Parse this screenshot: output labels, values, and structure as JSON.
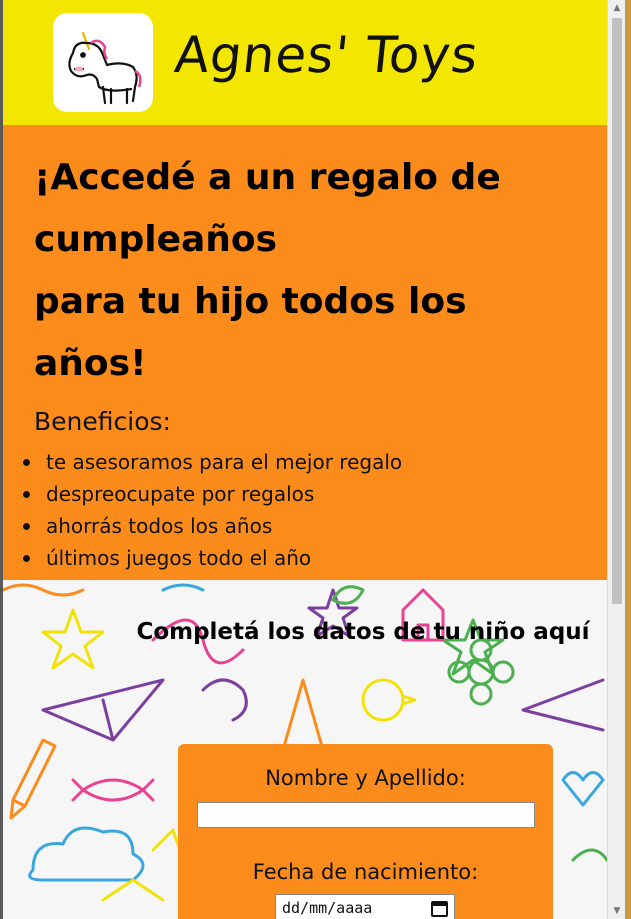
{
  "header": {
    "brand": "Agnes' Toys",
    "logo_icon": "unicorn-icon"
  },
  "hero": {
    "title_lines": [
      "¡Accedé a un regalo de",
      "cumpleaños",
      "para tu hijo todos los",
      "años!"
    ],
    "benefits_title": "Beneficios:",
    "benefits": [
      "te asesoramos para el mejor regalo",
      "despreocupate por regalos",
      "ahorrás todos los años",
      "últimos juegos todo el año"
    ]
  },
  "form": {
    "heading": "Completá los datos de tu niño aquí",
    "name_label": "Nombre y Apellido:",
    "name_value": "",
    "birth_label": "Fecha de nacimiento:",
    "birth_placeholder": "dd/mm/aaaa",
    "calendar_icon": "calendar-icon"
  },
  "colors": {
    "header_bg": "#f3e600",
    "hero_bg": "#fb8c1c",
    "card_bg": "#fb8c1c"
  }
}
